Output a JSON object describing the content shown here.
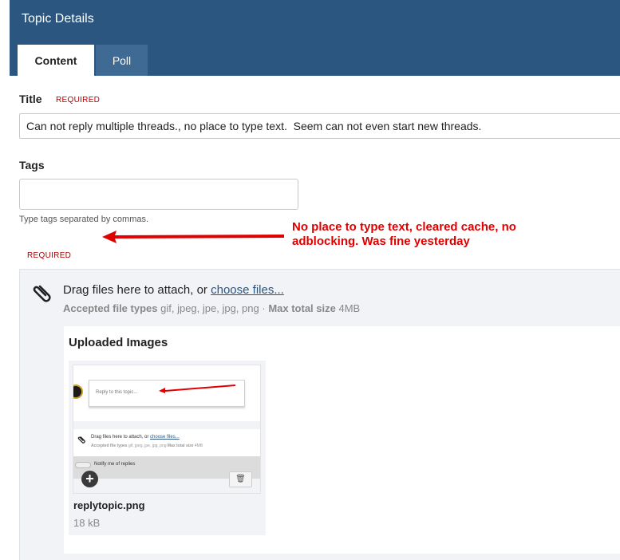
{
  "header": {
    "title": "Topic Details",
    "tabs": [
      {
        "label": "Content",
        "active": true
      },
      {
        "label": "Poll",
        "active": false
      }
    ]
  },
  "form": {
    "title_label": "Title",
    "title_required": "REQUIRED",
    "title_value": "Can not reply multiple threads., no place to type text.  Seem can not even start new threads.",
    "tags_label": "Tags",
    "tags_value": "",
    "tags_hint": "Type tags separated by commas.",
    "body_required": "REQUIRED"
  },
  "annotation": {
    "text": "No place to type text, cleared cache, no adblocking. Was fine yesterday",
    "color": "#e00000"
  },
  "attachments": {
    "drag_text": "Drag files here to attach, or",
    "choose_link": "choose files...",
    "accepted_label": "Accepted file types",
    "accepted_types": "gif, jpeg, jpe, jpg, png",
    "separator": "·",
    "max_label": "Max total size",
    "max_value": "4MB",
    "uploaded_title": "Uploaded Images",
    "files": [
      {
        "name": "replytopic.png",
        "size": "18 kB"
      }
    ],
    "thumbnail": {
      "reply_placeholder": "Reply to this topic...",
      "drag_text": "Drag files here to attach, or",
      "choose_link": "choose files...",
      "accepted_label": "Accepted file types",
      "accepted_types": "gif, jpeg, jpe, jpg, png",
      "max_label": "Max total size",
      "max_value": "4MB",
      "notify_label": "Notify me of replies",
      "plus_symbol": "+",
      "trash_symbol": "🗑"
    }
  },
  "colors": {
    "header_bg": "#2b5680",
    "tab_inactive_bg": "#3e6a93",
    "required": "#b20000",
    "link": "#2b5680"
  }
}
